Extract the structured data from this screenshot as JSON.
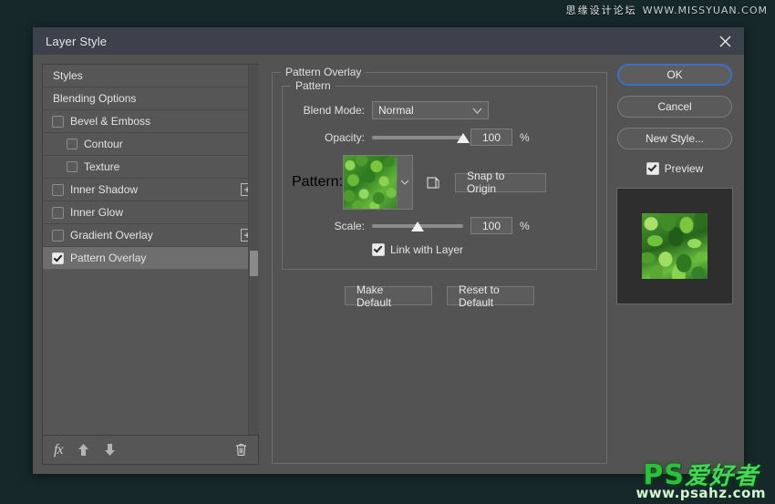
{
  "watermarks": {
    "top_cn": "思缘设计论坛",
    "top_url": "WWW.MISSYUAN.COM",
    "bottom_ps": "PS",
    "bottom_cn": "爱好者",
    "bottom_url": "www.psahz.com"
  },
  "dialog": {
    "title": "Layer Style",
    "close_icon": "close-icon"
  },
  "styles_panel": {
    "items": [
      {
        "label": "Styles",
        "type": "plain",
        "checkbox": false,
        "checked": false,
        "indent": false,
        "plus": false,
        "selected": false
      },
      {
        "label": "Blending Options",
        "type": "plain",
        "checkbox": false,
        "checked": false,
        "indent": false,
        "plus": false,
        "selected": false
      },
      {
        "label": "Bevel & Emboss",
        "type": "effect",
        "checkbox": true,
        "checked": false,
        "indent": false,
        "plus": false,
        "selected": false
      },
      {
        "label": "Contour",
        "type": "effect",
        "checkbox": true,
        "checked": false,
        "indent": true,
        "plus": false,
        "selected": false
      },
      {
        "label": "Texture",
        "type": "effect",
        "checkbox": true,
        "checked": false,
        "indent": true,
        "plus": false,
        "selected": false
      },
      {
        "label": "Inner Shadow",
        "type": "effect",
        "checkbox": true,
        "checked": false,
        "indent": false,
        "plus": true,
        "selected": false
      },
      {
        "label": "Inner Glow",
        "type": "effect",
        "checkbox": true,
        "checked": false,
        "indent": false,
        "plus": false,
        "selected": false
      },
      {
        "label": "Gradient Overlay",
        "type": "effect",
        "checkbox": true,
        "checked": false,
        "indent": false,
        "plus": true,
        "selected": false
      },
      {
        "label": "Pattern Overlay",
        "type": "effect",
        "checkbox": true,
        "checked": true,
        "indent": false,
        "plus": false,
        "selected": true
      }
    ],
    "plus_label": "+",
    "footer": {
      "fx_label": "fx",
      "up_icon": "arrow-up-icon",
      "down_icon": "arrow-down-icon",
      "trash_icon": "trash-icon"
    }
  },
  "pattern_overlay": {
    "group_title": "Pattern Overlay",
    "subgroup_title": "Pattern",
    "blend_mode": {
      "label": "Blend Mode:",
      "value": "Normal",
      "chevron_icon": "chevron-down-icon"
    },
    "opacity": {
      "label": "Opacity:",
      "value": "100",
      "unit": "%",
      "slider_percent": 100
    },
    "pattern": {
      "label": "Pattern:",
      "swatch_name": "green-foliage-pattern",
      "chevron_icon": "chevron-down-icon",
      "new_pattern_icon": "new-pattern-icon",
      "snap_button": "Snap to Origin"
    },
    "scale": {
      "label": "Scale:",
      "value": "100",
      "unit": "%",
      "slider_percent": 50
    },
    "link_with_layer": {
      "label": "Link with Layer",
      "checked": true
    },
    "make_default": "Make Default",
    "reset_to_default": "Reset to Default"
  },
  "actions": {
    "ok": "OK",
    "cancel": "Cancel",
    "new_style": "New Style...",
    "preview_label": "Preview",
    "preview_checked": true,
    "preview_image_name": "leaves-preview-thumbnail"
  },
  "colors": {
    "dialog_bg": "#535353",
    "titlebar_bg": "#3c414b",
    "canvas_bg": "#17282a",
    "accent_focus": "#3f6fc4",
    "selected_row": "#6e6e6e",
    "preview_bg": "#2e2e2e"
  }
}
